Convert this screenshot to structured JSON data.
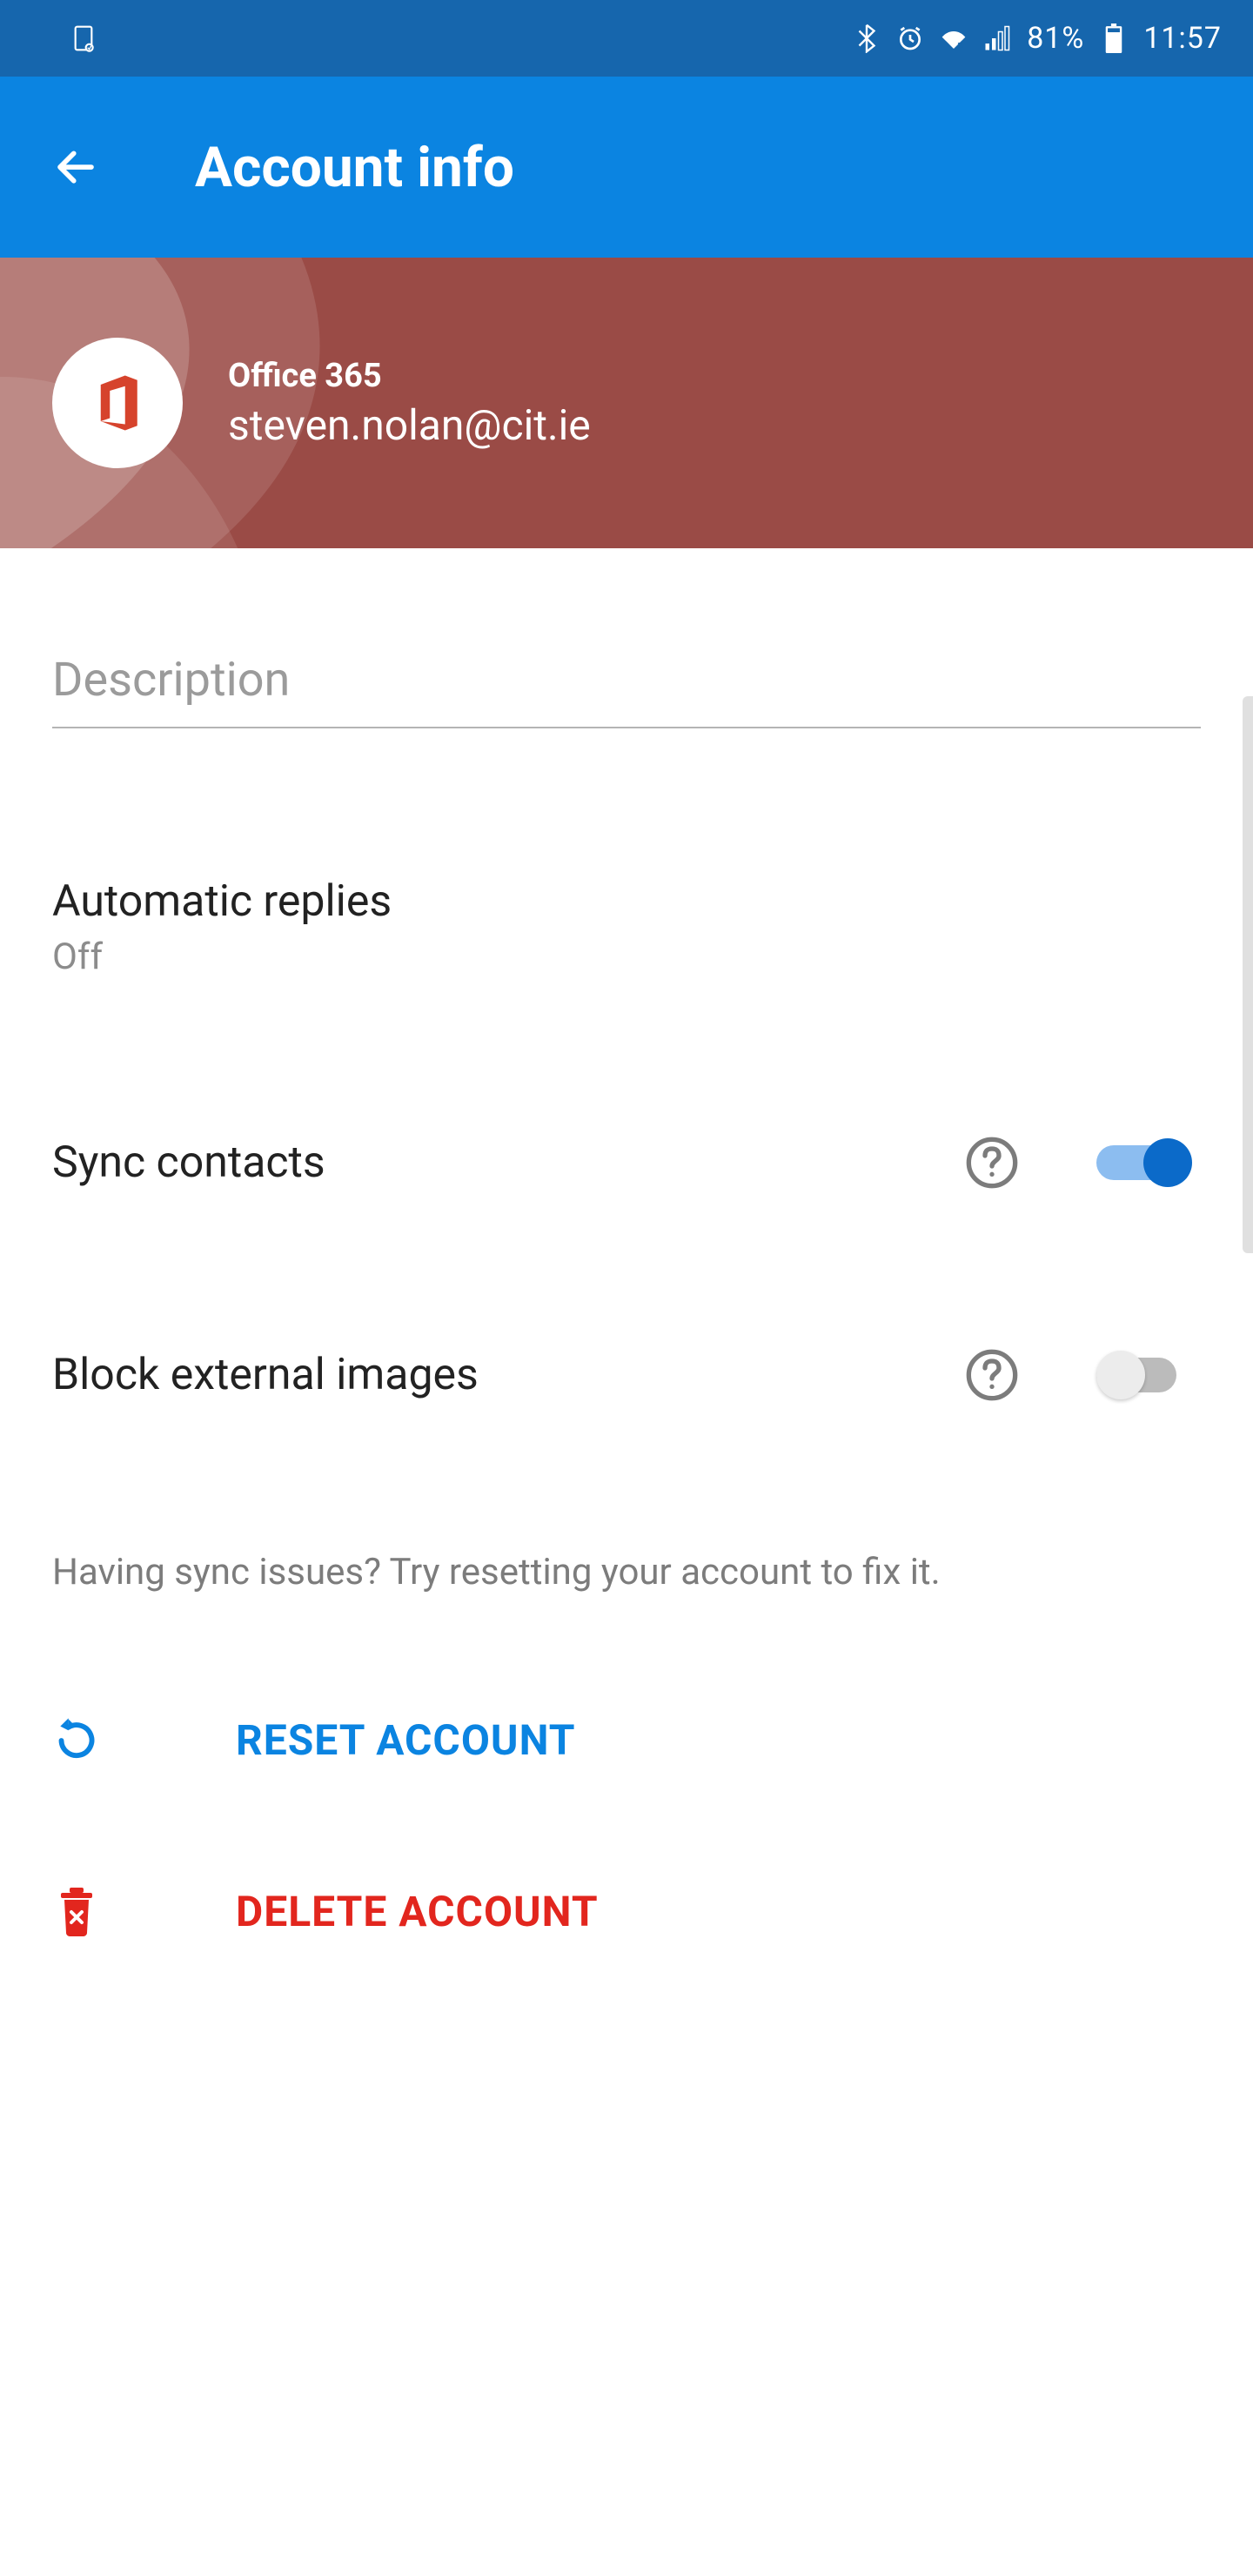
{
  "statusbar": {
    "battery_percent": "81%",
    "time": "11:57"
  },
  "appbar": {
    "title": "Account info"
  },
  "account": {
    "type": "Office 365",
    "email": "steven.nolan@cit.ie"
  },
  "description": {
    "placeholder": "Description",
    "value": ""
  },
  "settings": {
    "auto_replies": {
      "label": "Automatic replies",
      "value": "Off"
    },
    "sync_contacts": {
      "label": "Sync contacts",
      "enabled": true
    },
    "block_external_images": {
      "label": "Block external images",
      "enabled": false
    }
  },
  "hint": "Having sync issues? Try resetting your account to fix it.",
  "actions": {
    "reset": "RESET ACCOUNT",
    "delete": "DELETE ACCOUNT"
  }
}
